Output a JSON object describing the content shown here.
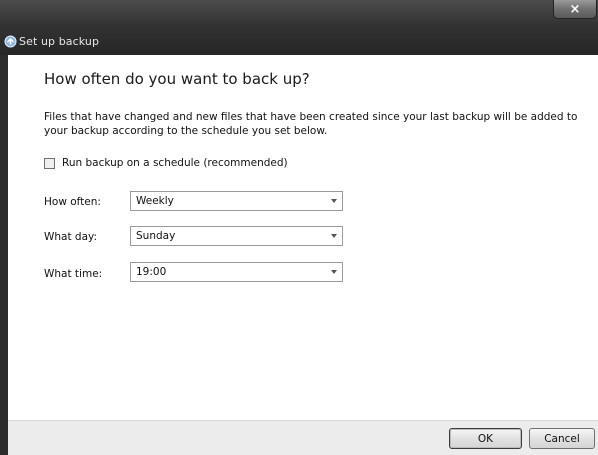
{
  "window": {
    "title": "Set up backup",
    "close_glyph": "×"
  },
  "main": {
    "heading": "How often do you want to back up?",
    "description": "Files that have changed and new files that have been created since your last backup will be added to your backup according to the schedule you set below.",
    "schedule_checkbox": {
      "label": "Run backup on a schedule (recommended)",
      "checked": false
    },
    "fields": [
      {
        "label": "How often:",
        "value": "Weekly"
      },
      {
        "label": "What day:",
        "value": "Sunday"
      },
      {
        "label": "What time:",
        "value": "19:00"
      }
    ]
  },
  "footer": {
    "ok_label": "OK",
    "cancel_label": "Cancel"
  }
}
